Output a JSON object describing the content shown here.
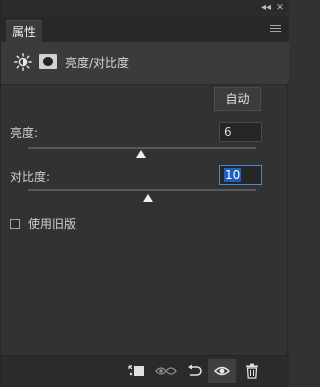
{
  "window": {
    "collapse_glyph": "◂◂",
    "close_glyph": "✕"
  },
  "tab": {
    "label": "属性"
  },
  "adjustment": {
    "title": "亮度/对比度",
    "icons": [
      "sun-icon",
      "layer-mask-icon"
    ]
  },
  "auto_button": {
    "label": "自动"
  },
  "brightness": {
    "label": "亮度:",
    "value": "6",
    "slider_position": 0.52
  },
  "contrast": {
    "label": "对比度:",
    "value": "10",
    "slider_position": 0.55
  },
  "use_legacy": {
    "label": "使用旧版",
    "checked": false
  },
  "bottom_toolbar": {
    "buttons": [
      "clip-to-layer-icon",
      "view-previous-state-icon",
      "reset-icon",
      "visibility-eye-icon",
      "delete-trash-icon"
    ]
  },
  "colors": {
    "panel_bg": "#323232",
    "accent_focus": "#4a8ad8",
    "selection": "#1f5fbf"
  }
}
